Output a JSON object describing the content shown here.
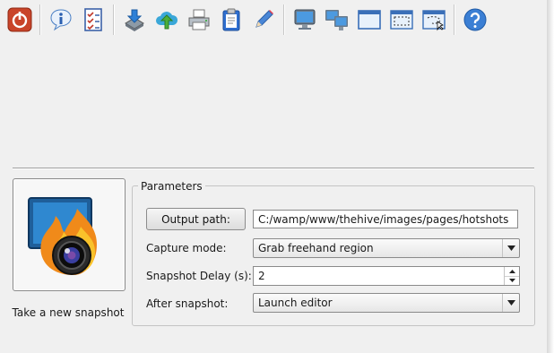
{
  "toolbar": {
    "icons": [
      "power-icon",
      "info-icon",
      "checklist-icon",
      "install-icon",
      "cloud-upload-icon",
      "printer-icon",
      "clipboard-icon",
      "pencil-icon",
      "monitor-icon",
      "multi-monitor-icon",
      "window-icon",
      "region-icon",
      "freehand-region-icon",
      "help-icon"
    ]
  },
  "snapshot": {
    "label": "Take a new snapshot"
  },
  "params": {
    "legend": "Parameters",
    "output_button": "Output path:",
    "output_path": "C:/wamp/www/thehive/images/pages/hotshots",
    "capture_label": "Capture mode:",
    "capture_value": "Grab freehand region",
    "delay_label": "Snapshot Delay (s):",
    "delay_value": "2",
    "after_label": "After snapshot:",
    "after_value": "Launch editor"
  }
}
